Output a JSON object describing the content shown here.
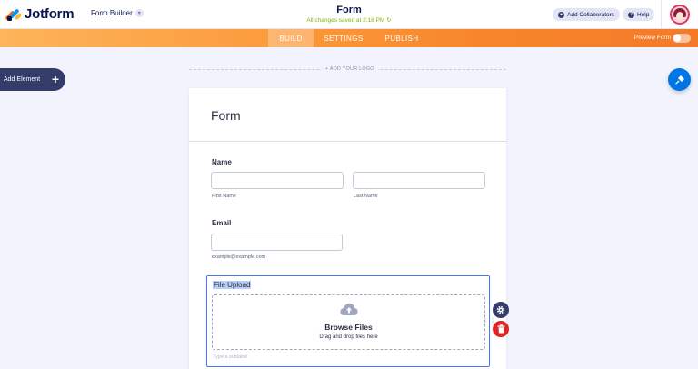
{
  "header": {
    "brand": "Jotform",
    "builder_label": "Form Builder",
    "form_title": "Form",
    "save_status": "All changes saved at 2:18 PM",
    "collab_label": "Add Collaborators",
    "help_label": "Help"
  },
  "tabs": [
    {
      "label": "BUILD",
      "active": true
    },
    {
      "label": "SETTINGS",
      "active": false
    },
    {
      "label": "PUBLISH",
      "active": false
    }
  ],
  "preview_label": "Preview Form",
  "preview_enabled": false,
  "add_element_label": "Add Element",
  "add_logo_label": "+ ADD YOUR LOGO",
  "form": {
    "title": "Form",
    "name_field": {
      "label": "Name",
      "first_sublabel": "First Name",
      "last_sublabel": "Last Name",
      "first_value": "",
      "last_value": ""
    },
    "email_field": {
      "label": "Email",
      "sublabel": "example@example.com",
      "value": ""
    },
    "upload_field": {
      "label": "File Upload",
      "browse_label": "Browse Files",
      "drag_text": "Drag and drop files here",
      "sublabel_placeholder": "Type a sublabel"
    }
  },
  "colors": {
    "accent_orange": "#f7852a",
    "upload_border": "#4277ff",
    "delete": "#dc2626",
    "saved_green": "#78bb07"
  },
  "icons": {
    "logo": "jotform-logo",
    "chevron": "chevron-down-icon",
    "user": "user-icon",
    "help": "help-icon",
    "add": "plus-icon",
    "paint": "paint-roller-icon",
    "cloud": "cloud-upload-icon",
    "gear": "gear-icon",
    "trash": "trash-icon",
    "drag": "drag-handle-icon"
  }
}
